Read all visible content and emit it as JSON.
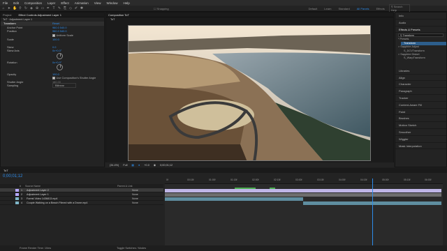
{
  "menu": [
    "File",
    "Edit",
    "Composition",
    "Layer",
    "Effect",
    "Animation",
    "View",
    "Window",
    "Help"
  ],
  "toolbar": {
    "snapping": "Snapping",
    "workspaces": [
      "Default",
      "Learn",
      "Standard",
      "Small Screen",
      "Libraries",
      "All Panels",
      "Effects"
    ],
    "search_placeholder": "Search Help"
  },
  "effect_controls": {
    "tabs": [
      "Project",
      "Effect Controls Adjustment Layer 1"
    ],
    "breadcrumb": "ToT · Adjustment Layer 1",
    "rows": [
      {
        "name": "Transform",
        "value": "Reset"
      },
      {
        "name": "Anchor Point",
        "value": "960.0  540.0"
      },
      {
        "name": "Position",
        "value": "960.0  540.0"
      },
      {
        "name": "",
        "value": "Uniform Scale"
      },
      {
        "name": "Scale",
        "value": "100.0"
      },
      {
        "name": "",
        "value": ""
      },
      {
        "name": "Skew",
        "value": "0.0"
      },
      {
        "name": "Skew Axis",
        "value": "0x+0.0°"
      },
      {
        "name": "Rotation",
        "value": "0x+0.0°"
      },
      {
        "name": "Opacity",
        "value": "100.0"
      },
      {
        "name": "",
        "value": "Use Composition's Shutter Angle"
      },
      {
        "name": "Shutter Angle",
        "value": "180.00"
      },
      {
        "name": "Sampling",
        "value": "Bilinear"
      }
    ]
  },
  "composition": {
    "tab": "Composition ToT",
    "subtab": "ToT",
    "viewer_bar": {
      "zoom": "(34.4%)",
      "resolution": "Full",
      "exposure": "+0.0",
      "timecode": "0;00;01;12"
    }
  },
  "right_panel": {
    "sections": [
      "Info",
      "Audio",
      "Effects & Presets"
    ],
    "search_value": "Transform",
    "results": [
      {
        "label": "* Presets",
        "highlight": false
      },
      {
        "label": "Transform",
        "highlight": true
      },
      {
        "label": "> Sapphire Adjust",
        "highlight": false
      },
      {
        "label": "S_DCVTransform",
        "highlight": false
      },
      {
        "label": "> Sapphire Distort",
        "highlight": false
      },
      {
        "label": "S_WarpTransform",
        "highlight": false
      }
    ],
    "lower_sections": [
      "Libraries",
      "Align",
      "Character",
      "Paragraph",
      "Tracker",
      "Content-Aware Fill",
      "Paint",
      "Brushes",
      "Motion Sketch",
      "Smoother",
      "Wiggler",
      "Mask Interpolation"
    ]
  },
  "timeline": {
    "tab": "ToT",
    "timecode": "0;00;01;12",
    "columns": [
      "#",
      "Source Name",
      "Parent & Link"
    ],
    "layers": [
      {
        "num": "1",
        "name": "Adjustment Layer 2",
        "parent": "None",
        "color": "#b5a8ff"
      },
      {
        "num": "2",
        "name": "Adjustment Layer 1",
        "parent": "None",
        "color": "#b5a8ff"
      },
      {
        "num": "3",
        "name": "Forest Video 1436813.mp4",
        "parent": "None",
        "color": "#7fb6c8"
      },
      {
        "num": "4",
        "name": "Couple Walking on a Beach Filmed with a Drone.mp4",
        "parent": "None",
        "color": "#7fb6c8"
      }
    ],
    "ruler_ticks": [
      "0f",
      "00:15f",
      "01:00f",
      "01:15f",
      "02:00f",
      "02:15f",
      "03:00f",
      "03:15f",
      "04:00f",
      "04:15f",
      "05:00f",
      "05:15f",
      "06:00f"
    ],
    "footer": {
      "render_time": "Frame Render Time: 10ms",
      "toggle": "Toggle Switches / Modes"
    }
  }
}
